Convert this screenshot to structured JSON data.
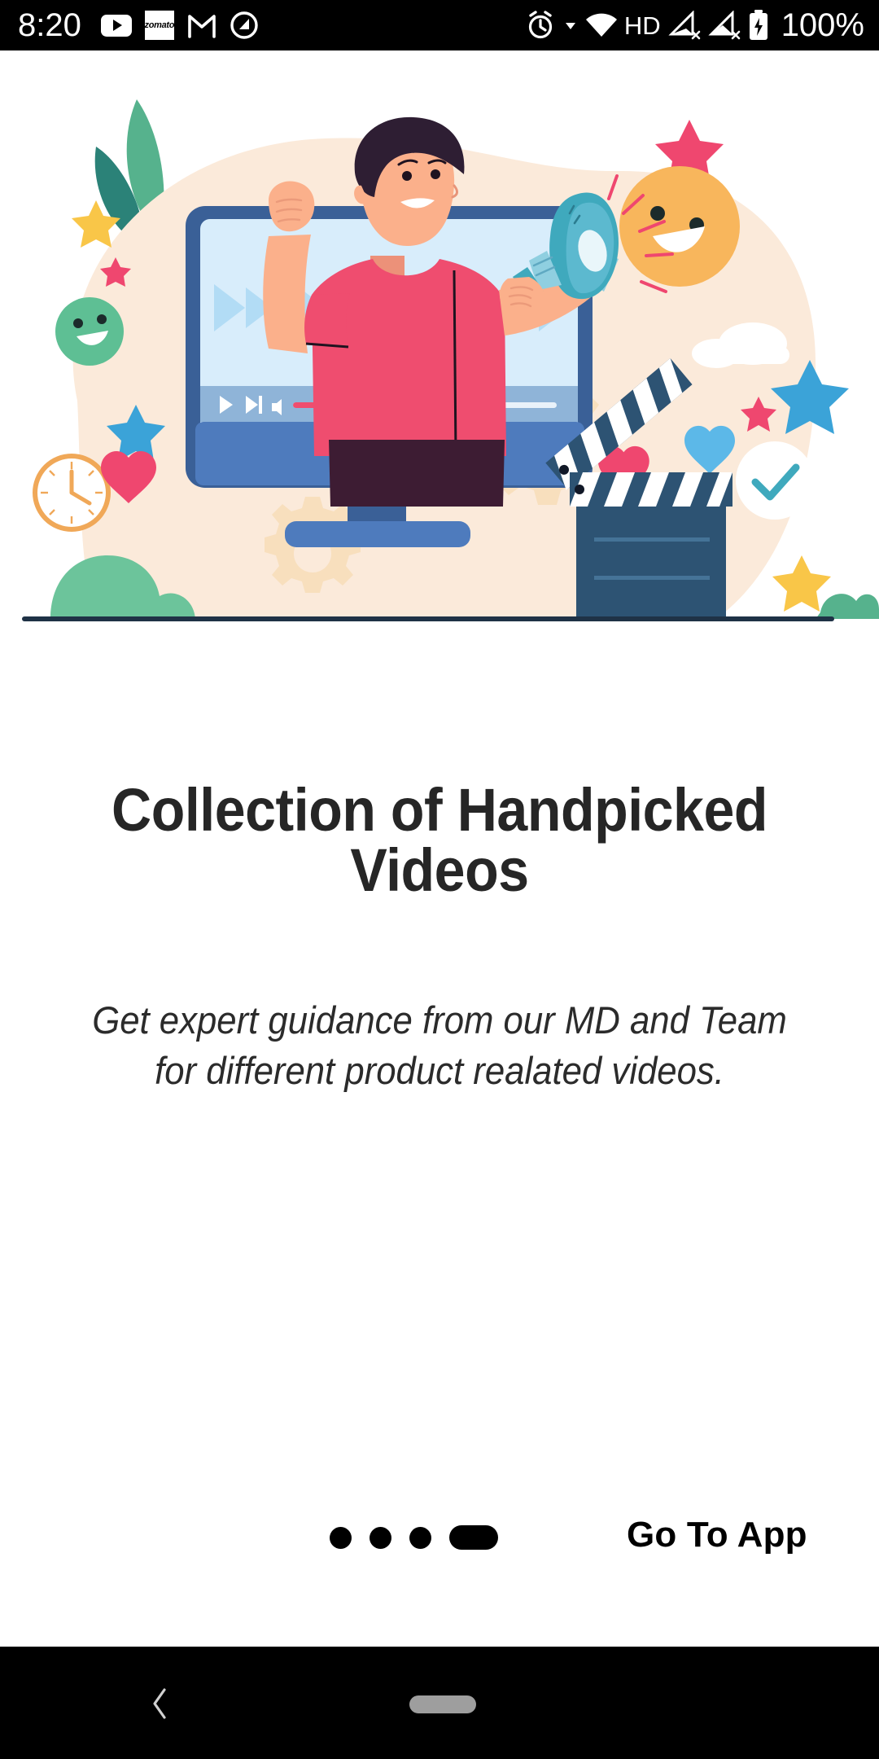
{
  "statusbar": {
    "time": "8:20",
    "left_icons": [
      {
        "name": "youtube-icon",
        "label": "YouTube"
      },
      {
        "name": "zomato-icon",
        "label": "zomato"
      },
      {
        "name": "gmail-icon",
        "label": "M"
      },
      {
        "name": "app-circle-icon",
        "label": "Q"
      }
    ],
    "right_icons": [
      {
        "name": "alarm-icon",
        "label": "Alarm"
      },
      {
        "name": "wifi-icon",
        "label": "Wi-Fi"
      },
      {
        "name": "hd-indicator",
        "label": "HD"
      },
      {
        "name": "signal-no-sim-1-icon",
        "label": "No SIM 1"
      },
      {
        "name": "signal-no-sim-2-icon",
        "label": "No SIM 2"
      },
      {
        "name": "battery-charging-icon",
        "label": "Charging"
      }
    ],
    "hd_label": "HD",
    "battery_percent": "100%"
  },
  "illustration": {
    "name": "handpicked-videos-illustration",
    "alt": "Man with raised fist holding a megaphone standing in front of a desktop monitor playing a video, surrounded by gears, stars, hearts, clouds, a clapperboard and a checkmark",
    "colors": {
      "blob": "#fbeada",
      "monitor_frame": "#3a6097",
      "monitor_screen": "#d8edfb",
      "monitor_base": "#4e7bbd",
      "shirt": "#ef4d6f",
      "skin": "#fbb08b",
      "hair": "#2e1e33",
      "pants": "#3d1c33",
      "megaphone": "#3fa9bd",
      "megaphone_light": "#8fcfe0",
      "clapper_dark": "#2d5373",
      "leaf_green": "#56b28d",
      "leaf_teal": "#2b8278",
      "bush_green": "#6cc49b",
      "gear": "#f8dfbd",
      "star_yellow": "#f9c648",
      "star_blue": "#3ba3d8",
      "star_pink": "#ef476f",
      "heart_pink": "#ef476f",
      "heart_blue": "#5cb8e8",
      "smiley_orange": "#f8b65c",
      "smiley_green": "#5ebf94",
      "progress_track": "#e9f2fa",
      "progress_fill": "#ef4d6f",
      "checkmark": "#3fa9bd",
      "ground_line": "#1f3246",
      "clock_ring": "#f0a858"
    },
    "player_controls": [
      "play-icon",
      "next-icon",
      "volume-icon"
    ],
    "progress_percent": 52
  },
  "content": {
    "title": "Collection of Handpicked Videos",
    "subtitle": "Get expert guidance from our MD and Team for different product realated videos."
  },
  "pager": {
    "total": 4,
    "active_index": 3,
    "dots": [
      "page-1",
      "page-2",
      "page-3",
      "page-4"
    ]
  },
  "actions": {
    "primary_label": "Go To App"
  },
  "navbar": {
    "back_label": "Back",
    "home_label": "Home"
  }
}
